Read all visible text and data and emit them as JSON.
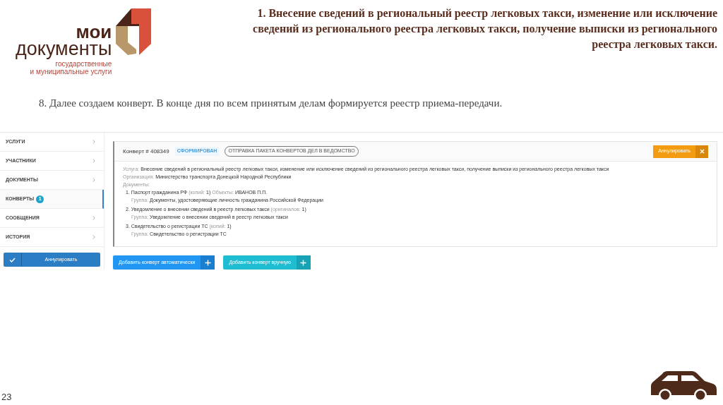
{
  "logo": {
    "line_1": "мои",
    "line_2": "документы",
    "tagline_1": "государственные",
    "tagline_2": "и муниципальные услуги"
  },
  "slide_title": "1. Внесение сведений в региональный реестр легковых такси, изменение или исключение сведений из регионального реестра легковых такси, получение выписки из регионального реестра легковых такси.",
  "step_text": "8. Далее создаем конверт. В конце дня по всем принятым делам формируется реестр приема-передачи.",
  "sidebar": {
    "items": [
      {
        "label": "УСЛУГИ",
        "selected": false
      },
      {
        "label": "УЧАСТНИКИ",
        "selected": false
      },
      {
        "label": "ДОКУМЕНТЫ",
        "selected": false
      },
      {
        "label": "КОНВЕРТЫ",
        "selected": true,
        "badge": "1"
      },
      {
        "label": "СООБЩЕНИЯ",
        "selected": false
      },
      {
        "label": "ИСТОРИЯ",
        "selected": false
      }
    ],
    "cancel_button": "Аннулировать"
  },
  "envelope": {
    "title": "Конверт # 408349",
    "status": "СФОРМИРОВАН",
    "action_tag": "ОТПРАВКА ПАКЕТА КОНВЕРТОВ ДЕЛ В ВЕДОМСТВО",
    "cancel_button": "Аннулировать",
    "fields": [
      {
        "label": "Услуга:",
        "value": "Внесение сведений в региональный реестр легковых такси, изменение или исключение сведений из регионального реестра легковых такси, получение выписки из регионального реестра легковых такси"
      },
      {
        "label": "Организация:",
        "value": "Министерство транспорта Донецкой Народной Республики"
      }
    ],
    "documents_label": "Документы:",
    "documents": [
      {
        "name": "1. Паспорт гражданина РФ",
        "count_label": "(копий:",
        "count": "1)",
        "object_label": "Объекты:",
        "object": "ИВАНОВ П.П.",
        "group_label": "Группа:",
        "group": "Документы, удостоверяющие личность гражданина Российской Федерации"
      },
      {
        "name": "2. Уведомление о внесении сведений в реестр легковых такси",
        "count_label": "(оригиналов:",
        "count": "1)",
        "group_label": "Группа:",
        "group": "Уведомление о внесении сведений в реестр легковых такси"
      },
      {
        "name": "3. Свидетельство о регистрации ТС",
        "count_label": "(копий:",
        "count": "1)",
        "group_label": "Группа:",
        "group": "Свидетельство о регистрации ТС"
      }
    ]
  },
  "add_buttons": [
    {
      "label": "Добавить конверт автоматически",
      "kind": "primary"
    },
    {
      "label": "Добавить конверт вручную",
      "kind": "secondary"
    }
  ],
  "page_number": "23"
}
